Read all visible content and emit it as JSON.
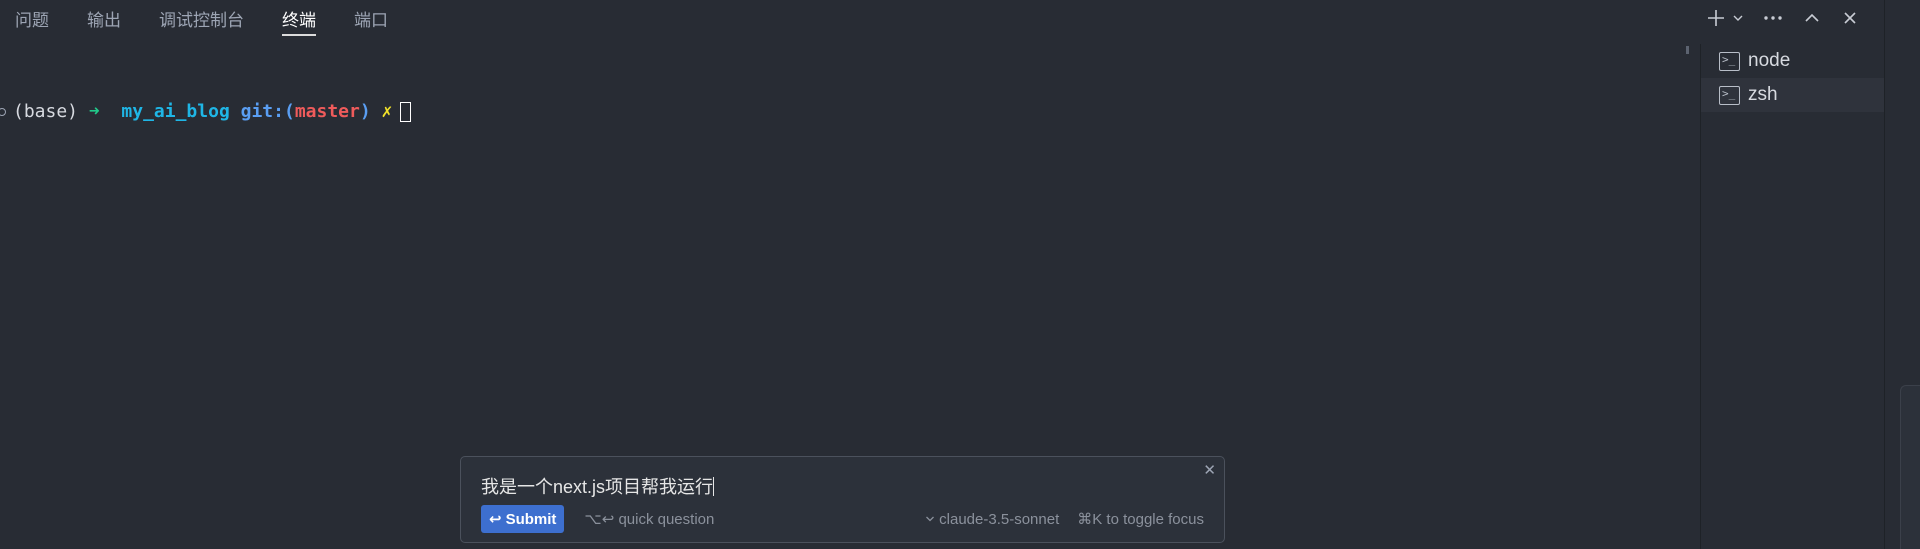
{
  "panel": {
    "tabs": [
      {
        "label": "问题",
        "active": false
      },
      {
        "label": "输出",
        "active": false
      },
      {
        "label": "调试控制台",
        "active": false
      },
      {
        "label": "终端",
        "active": true
      },
      {
        "label": "端口",
        "active": false
      }
    ]
  },
  "actions": {
    "new_terminal_icon": "plus-icon",
    "dropdown_icon": "chevron-down-icon",
    "more_icon": "ellipsis-icon",
    "maximize_icon": "chevron-up-icon",
    "close_icon": "close-icon"
  },
  "terminal": {
    "env": "(base)",
    "arrow": "➜",
    "directory": "my_ai_blog",
    "git_label": "git:(",
    "branch": "master",
    "git_close": ")",
    "dirty_mark": "✗"
  },
  "terminal_list": {
    "items": [
      {
        "label": "node",
        "selected": false
      },
      {
        "label": "zsh",
        "selected": true
      }
    ]
  },
  "ai_prompt": {
    "input_text": "我是一个next.js项目帮我运行",
    "submit_label": "Submit",
    "submit_icon": "↩",
    "quick_question": "⌥↩ quick question",
    "model": "claude-3.5-sonnet",
    "toggle_hint": "⌘K to toggle focus",
    "close_glyph": "✕"
  },
  "colors": {
    "background": "#282c34",
    "accent": "#3d6fcf",
    "branch": "#ef5b5b",
    "arrow": "#21c98a",
    "directory": "#1fb6e6"
  }
}
